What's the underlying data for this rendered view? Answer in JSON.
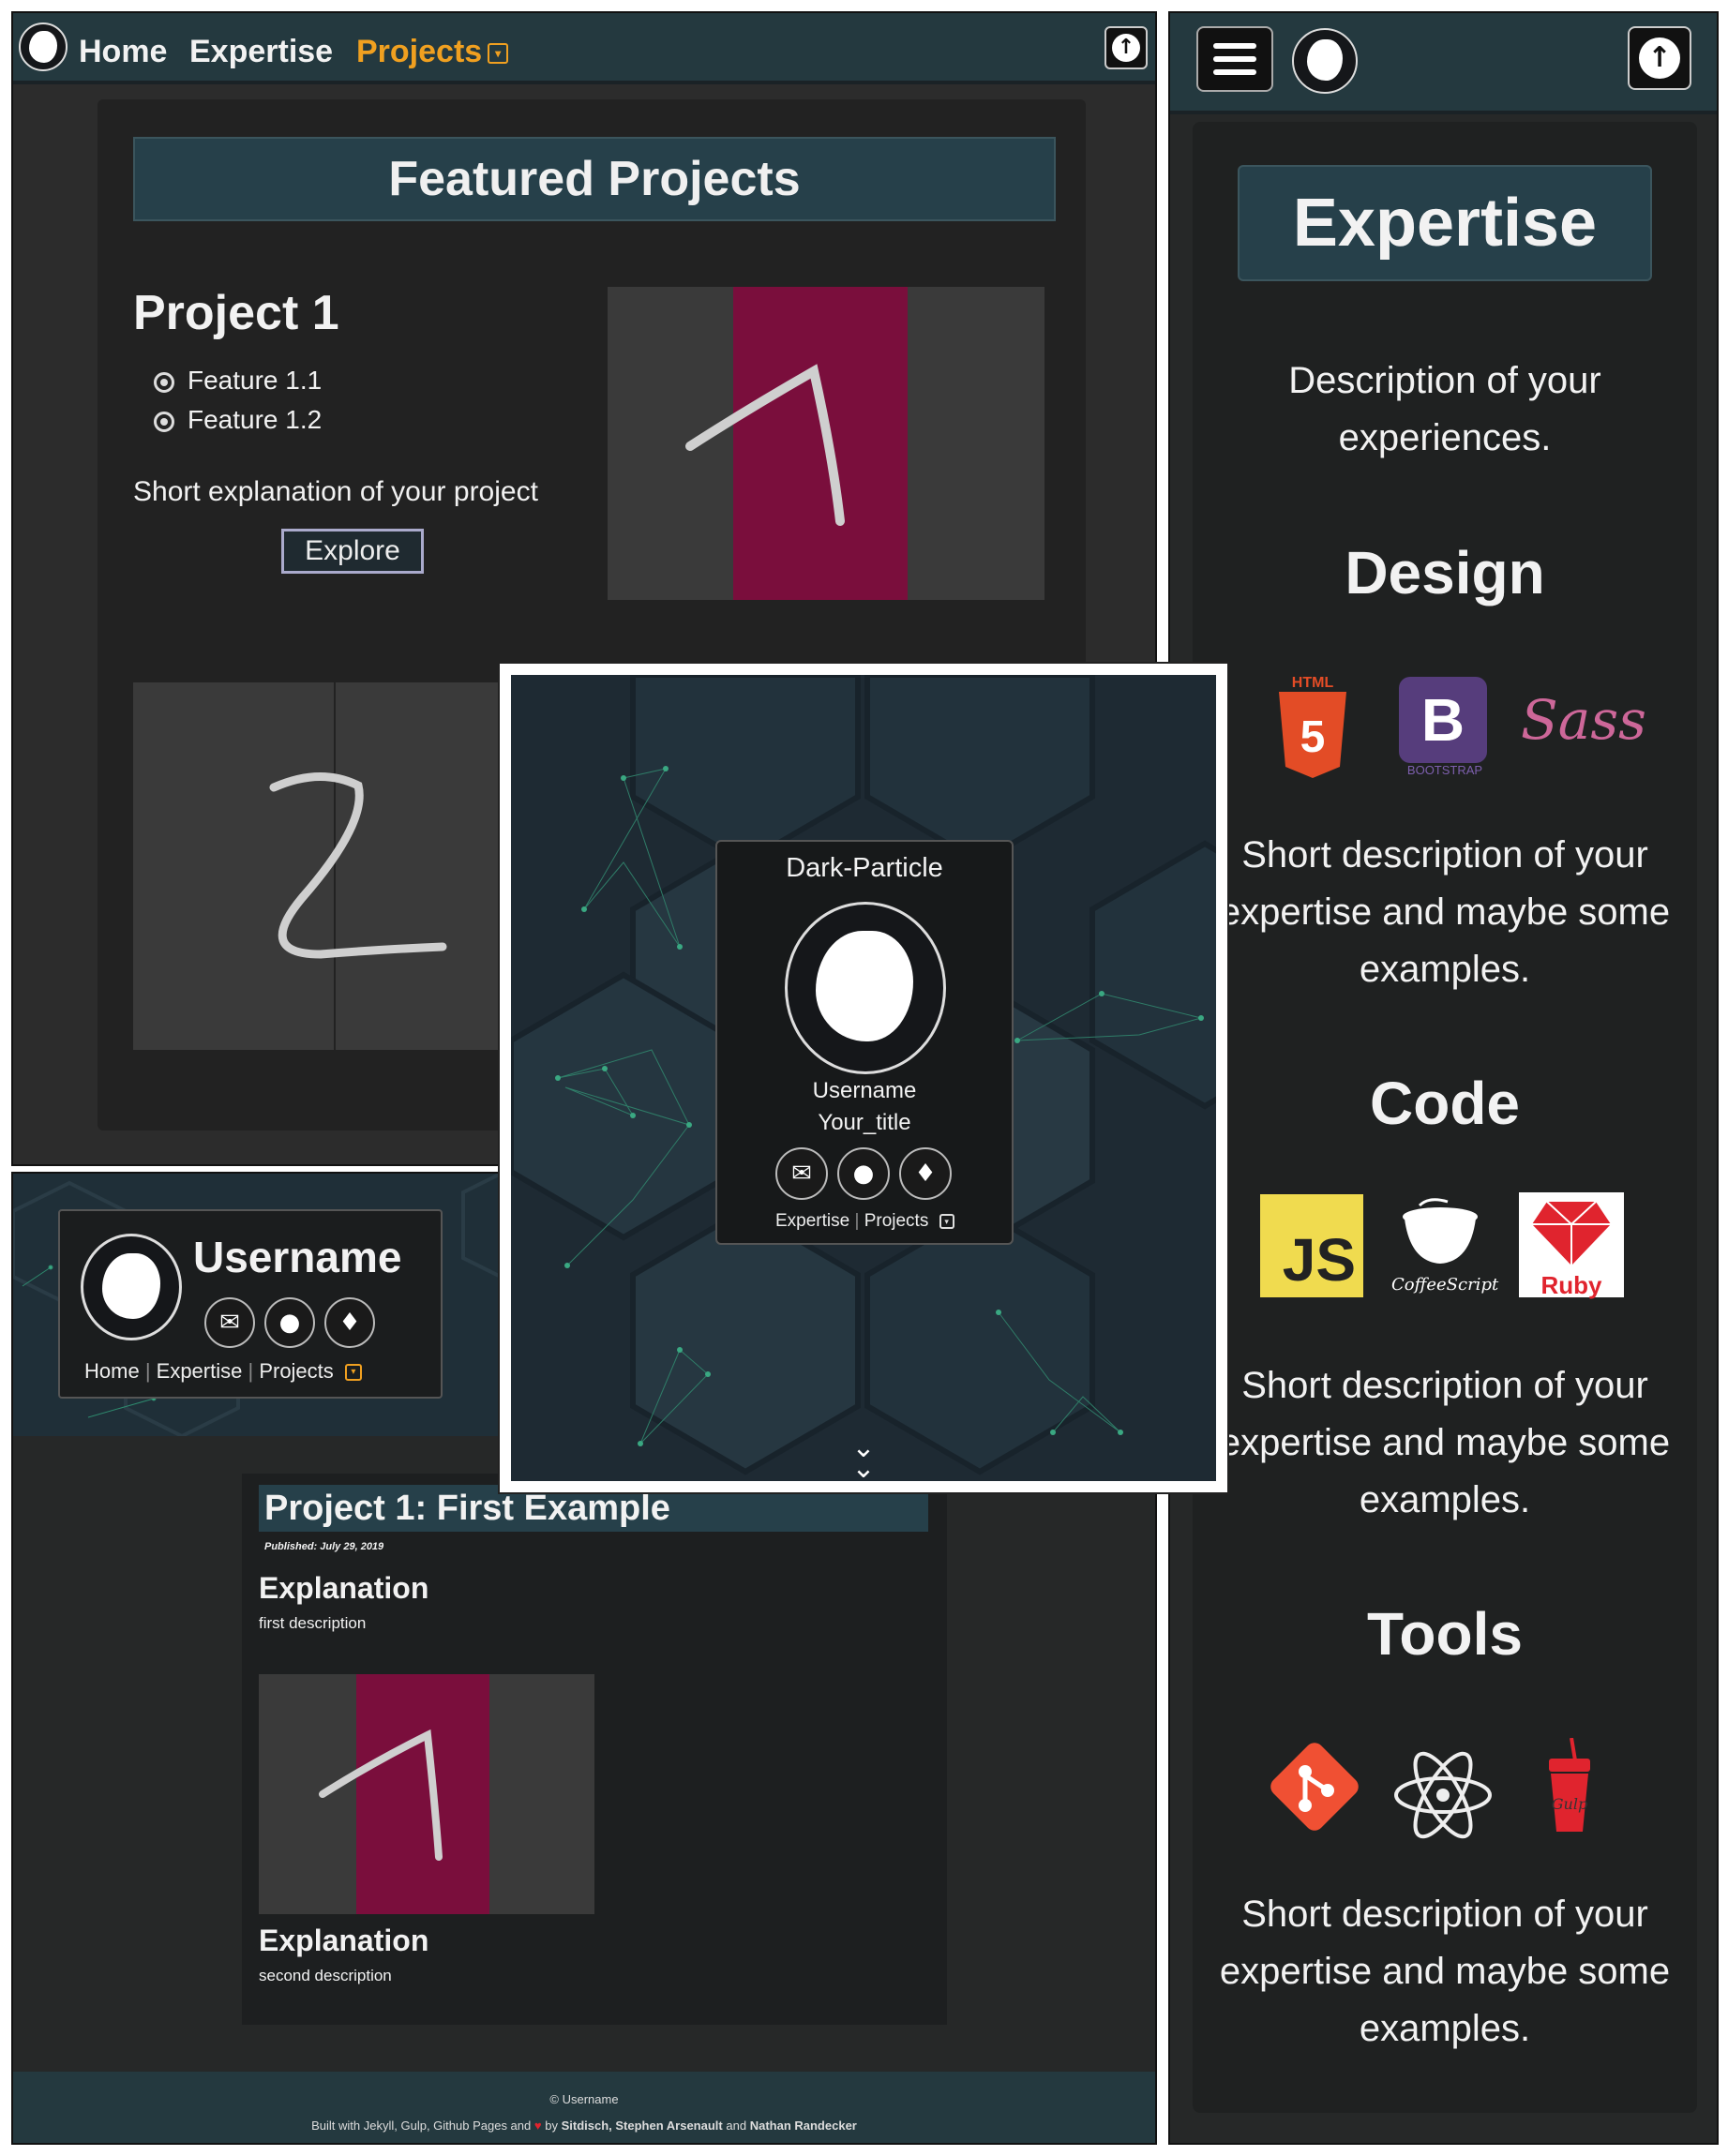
{
  "projects_panel": {
    "nav": {
      "home": "Home",
      "expertise": "Expertise",
      "projects": "Projects",
      "caret": "▾",
      "up_icon": "arrow-up-icon"
    },
    "header": "Featured Projects",
    "project1": {
      "title": "Project 1",
      "features": [
        "Feature 1.1",
        "Feature 1.2"
      ],
      "text": "Short explanation of your project",
      "button": "Explore",
      "image_digit": "1"
    },
    "project2": {
      "image_digit": "2"
    }
  },
  "expertise_panel": {
    "header": "Expertise",
    "description": "Description of your experiences.",
    "sections": [
      {
        "title": "Design",
        "icons": [
          "HTML",
          "B",
          "BOOTSTRAP",
          "Sass"
        ],
        "text": "Short description of your expertise and maybe some examples."
      },
      {
        "title": "Code",
        "icons": [
          "JS",
          "CoffeeScript",
          "Ruby"
        ],
        "text": "Short description of your expertise and maybe some examples."
      },
      {
        "title": "Tools",
        "icons": [
          "git-icon",
          "atom-icon",
          "gulp-icon"
        ],
        "text": "Short description of your expertise and maybe some examples."
      }
    ]
  },
  "post_panel": {
    "username": "Username",
    "nav": {
      "home": "Home",
      "expertise": "Expertise",
      "projects": "Projects"
    },
    "title": "Project 1: First Example",
    "published": "Published: July 29, 2019",
    "section1": {
      "heading": "Explanation",
      "text": "first description"
    },
    "section2": {
      "heading": "Explanation",
      "text": "second description"
    },
    "footer": {
      "copyright": "© Username",
      "built_prefix": "Built with Jekyll, Gulp, Github Pages and",
      "built_by": "by",
      "authors": "Sitdisch, Stephen Arsenault",
      "and": "and",
      "author_last": "Nathan Randecker"
    }
  },
  "landing_panel": {
    "title": "Dark-Particle",
    "username": "Username",
    "user_title": "Your_title",
    "nav": {
      "expertise": "Expertise",
      "projects": "Projects"
    },
    "scroll_icon": "double-chevron-down-icon"
  },
  "colors": {
    "accent": "#f0a020",
    "header_bg": "#26404a",
    "crimson": "#7a0e3c",
    "love": "#e0242e"
  }
}
